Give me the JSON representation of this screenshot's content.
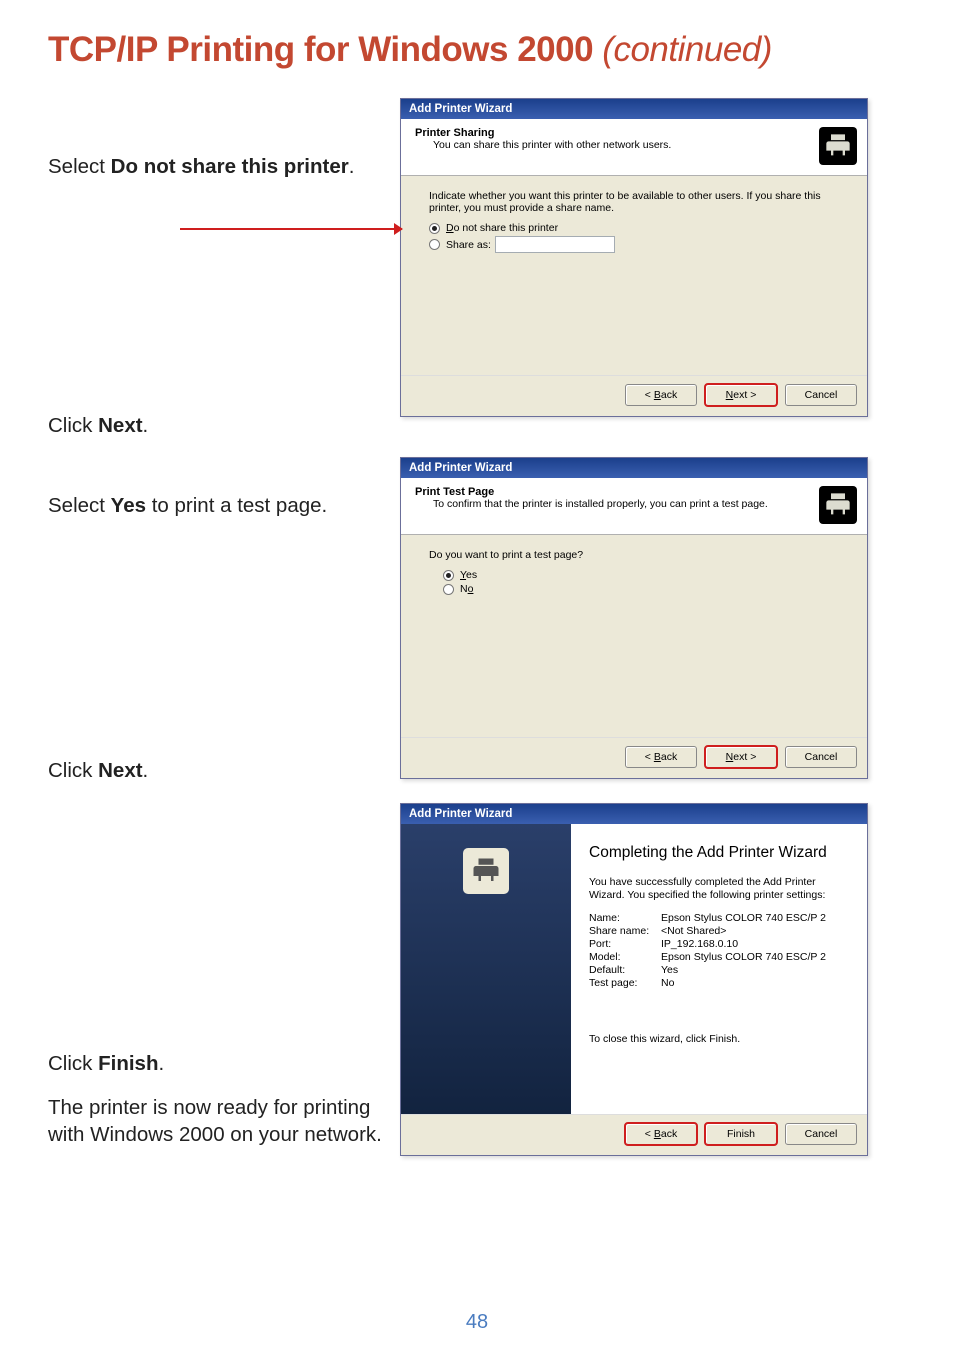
{
  "page": {
    "title_main": "TCP/IP Printing for Windows 2000 ",
    "title_cont": "(continued)",
    "number": "48"
  },
  "instructions": {
    "sel_no_share_pre": "Select ",
    "sel_no_share_bold": "Do not share this printer",
    "click_next_pre": "Click  ",
    "click_next_bold": "Next",
    "sel_yes_pre": "Select ",
    "sel_yes_bold": "Yes",
    "sel_yes_post": " to print a test page.",
    "click_finish_pre": "Click ",
    "click_finish_bold": "Finish",
    "ready_text": "The printer is now ready for printing with Windows 2000  on your network."
  },
  "dlg1": {
    "title": "Add Printer Wizard",
    "head_main": "Printer Sharing",
    "head_sub": "You can share this printer with other network users.",
    "body_intro": "Indicate whether you want this printer to be available to other users. If you share this printer, you must provide a share name.",
    "opt_no_share": "Do not share this printer",
    "opt_share_as": "Share as:",
    "btn_back": "< Back",
    "btn_next": "Next >",
    "btn_cancel": "Cancel"
  },
  "dlg2": {
    "title": "Add Printer Wizard",
    "head_main": "Print Test Page",
    "head_sub": "To confirm that the printer is installed properly, you can print a test page.",
    "question": "Do you want to print a test page?",
    "opt_yes": "Yes",
    "opt_no": "No",
    "btn_back": "< Back",
    "btn_next": "Next >",
    "btn_cancel": "Cancel"
  },
  "dlg3": {
    "title": "Add Printer Wizard",
    "heading": "Completing the Add Printer Wizard",
    "sub": "You have successfully completed the Add Printer Wizard. You specified the following printer settings:",
    "kv": {
      "name_k": "Name:",
      "name_v": "Epson Stylus COLOR 740 ESC/P 2",
      "share_k": "Share name:",
      "share_v": "<Not Shared>",
      "port_k": "Port:",
      "port_v": "IP_192.168.0.10",
      "model_k": "Model:",
      "model_v": "Epson Stylus COLOR 740 ESC/P 2",
      "default_k": "Default:",
      "default_v": "Yes",
      "test_k": "Test page:",
      "test_v": "No"
    },
    "close_hint": "To close this wizard, click Finish.",
    "btn_back": "< Back",
    "btn_finish": "Finish",
    "btn_cancel": "Cancel"
  }
}
